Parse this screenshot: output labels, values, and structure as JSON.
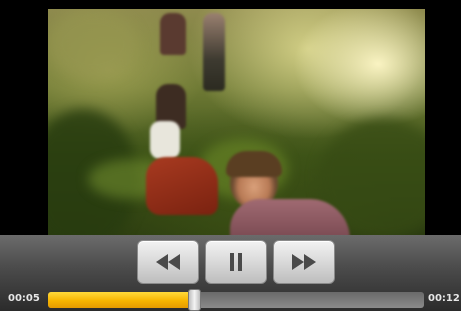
{
  "player": {
    "elapsed_time": "00:05",
    "total_time": "00:12",
    "progress_fraction": 0.39,
    "buttons": {
      "rewind_icon": "rewind-icon",
      "pause_icon": "pause-icon",
      "fast_forward_icon": "fast-forward-icon"
    },
    "colors": {
      "progress_fill": "#f7b500",
      "track": "#7a7a7a",
      "control_bar": "#4a4a4a"
    }
  }
}
